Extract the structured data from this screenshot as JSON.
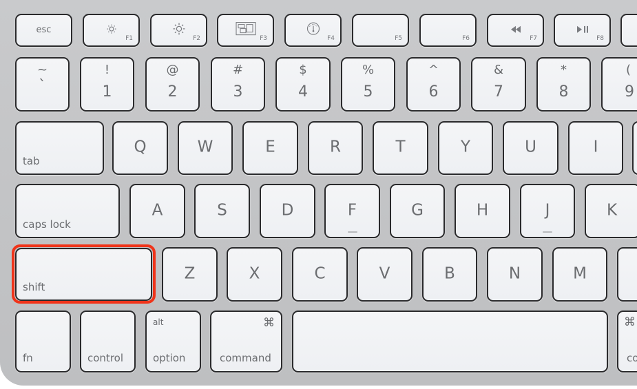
{
  "keyboard": {
    "highlight_color": "#f0341a",
    "highlighted_key": "shift",
    "row_function": {
      "esc": "esc",
      "f1": {
        "label": "F1",
        "icon": "brightness-down-icon"
      },
      "f2": {
        "label": "F2",
        "icon": "brightness-up-icon"
      },
      "f3": {
        "label": "F3",
        "icon": "expose-icon"
      },
      "f4": {
        "label": "F4",
        "icon": "dashboard-icon"
      },
      "f5": {
        "label": "F5"
      },
      "f6": {
        "label": "F6"
      },
      "f7": {
        "label": "F7",
        "icon": "rewind-icon",
        "glyph": "◀◀"
      },
      "f8": {
        "label": "F8",
        "icon": "play-pause-icon",
        "glyph": "▶II"
      }
    },
    "row_number": [
      {
        "top": "~",
        "bottom": "`"
      },
      {
        "top": "!",
        "bottom": "1"
      },
      {
        "top": "@",
        "bottom": "2"
      },
      {
        "top": "#",
        "bottom": "3"
      },
      {
        "top": "$",
        "bottom": "4"
      },
      {
        "top": "%",
        "bottom": "5"
      },
      {
        "top": "^",
        "bottom": "6"
      },
      {
        "top": "&",
        "bottom": "7"
      },
      {
        "top": "*",
        "bottom": "8"
      },
      {
        "top": "(",
        "bottom": "9"
      }
    ],
    "row_qwerty": {
      "tab": "tab",
      "letters": [
        "Q",
        "W",
        "E",
        "R",
        "T",
        "Y",
        "U",
        "I"
      ]
    },
    "row_home": {
      "caps_lock": "caps lock",
      "letters": [
        "A",
        "S",
        "D",
        "F",
        "G",
        "H",
        "J",
        "K"
      ]
    },
    "row_bottom": {
      "shift": "shift",
      "letters": [
        "Z",
        "X",
        "C",
        "V",
        "B",
        "N",
        "M"
      ]
    },
    "row_modifiers": {
      "fn": "fn",
      "control": "control",
      "option": "option",
      "option_alt": "alt",
      "command": "command",
      "command_symbol": "⌘",
      "right_command_symbol": "⌘",
      "right_command_partial": "co"
    }
  }
}
